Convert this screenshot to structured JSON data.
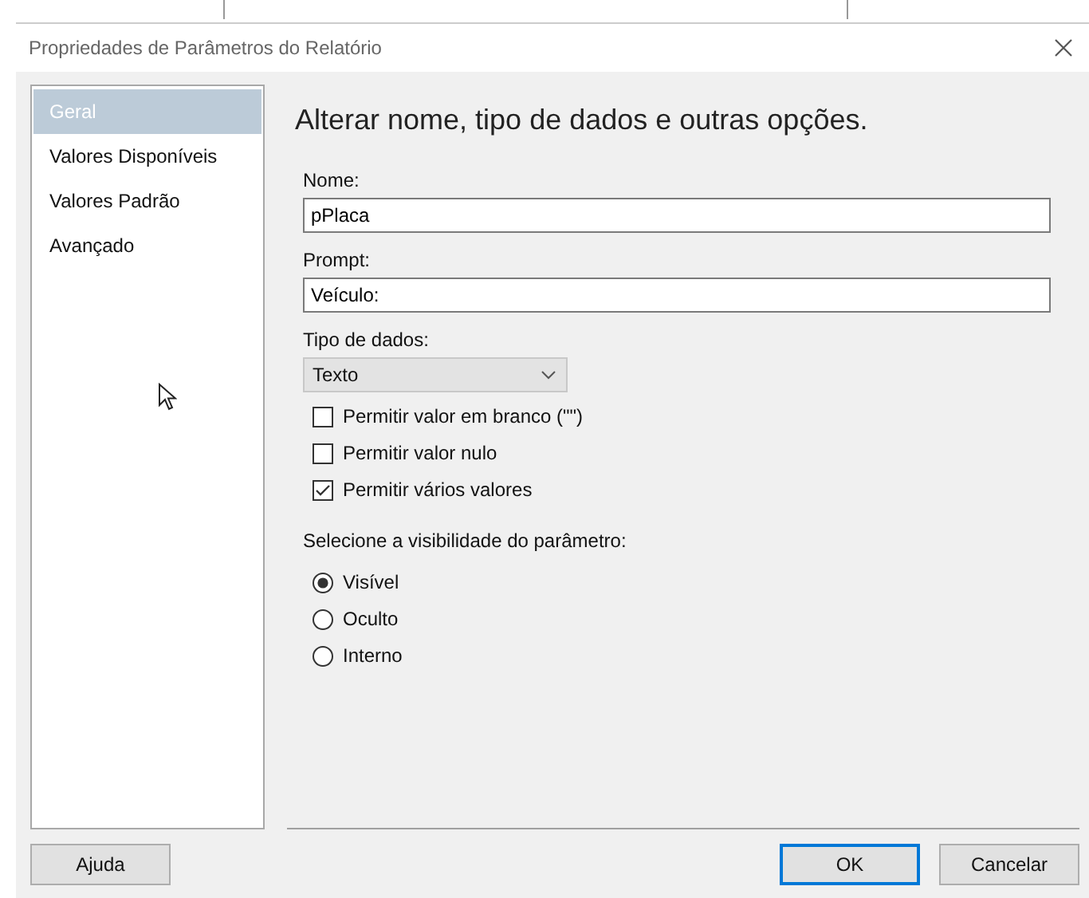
{
  "window": {
    "title": "Propriedades de Parâmetros do Relatório"
  },
  "sidebar": {
    "items": [
      {
        "label": "Geral",
        "selected": true
      },
      {
        "label": "Valores Disponíveis",
        "selected": false
      },
      {
        "label": "Valores Padrão",
        "selected": false
      },
      {
        "label": "Avançado",
        "selected": false
      }
    ]
  },
  "heading": "Alterar nome, tipo de dados e outras opções.",
  "name_field": {
    "label": "Nome:",
    "value": "pPlaca"
  },
  "prompt_field": {
    "label": "Prompt:",
    "value": "Veículo:"
  },
  "data_type": {
    "label": "Tipo de dados:",
    "value": "Texto"
  },
  "options": [
    {
      "label": "Permitir valor em branco (\"\")",
      "checked": false
    },
    {
      "label": "Permitir valor nulo",
      "checked": false
    },
    {
      "label": "Permitir vários valores",
      "checked": true
    }
  ],
  "visibility": {
    "label": "Selecione a visibilidade do parâmetro:",
    "choices": [
      {
        "label": "Visível",
        "selected": true
      },
      {
        "label": "Oculto",
        "selected": false
      },
      {
        "label": "Interno",
        "selected": false
      }
    ]
  },
  "buttons": [
    {
      "label": "Ajuda",
      "kind": "help"
    },
    {
      "label": "OK",
      "kind": "default"
    },
    {
      "label": "Cancelar",
      "kind": "normal"
    }
  ]
}
